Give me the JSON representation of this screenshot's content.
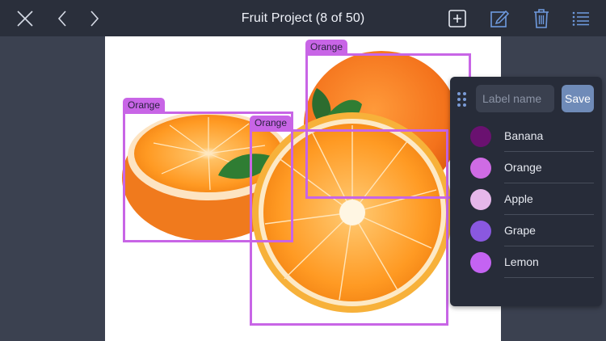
{
  "topbar": {
    "title": "Fruit Project (8 of 50)",
    "icons": {
      "close": "close-icon",
      "previous": "chevron-left-icon",
      "next": "chevron-right-icon",
      "add": "add-box-icon",
      "edit": "edit-icon",
      "delete": "trash-icon",
      "list": "list-icon"
    }
  },
  "annotations": [
    {
      "label": "Orange",
      "color": "#c865e6"
    },
    {
      "label": "Orange",
      "color": "#c865e6"
    },
    {
      "label": "Orange",
      "color": "#c865e6"
    }
  ],
  "label_panel": {
    "input_placeholder": "Label name",
    "input_value": "",
    "save_label": "Save",
    "labels": [
      {
        "name": "Banana",
        "color": "#6a1170"
      },
      {
        "name": "Orange",
        "color": "#cf6be4"
      },
      {
        "name": "Apple",
        "color": "#e6b7ea"
      },
      {
        "name": "Grape",
        "color": "#8a58e0"
      },
      {
        "name": "Lemon",
        "color": "#c463f2"
      }
    ]
  },
  "colors": {
    "topbar_bg": "#2a2f3b",
    "canvas_bg": "#3b4150",
    "bbox": "#c865e6",
    "save_button": "#6f8bb8"
  }
}
